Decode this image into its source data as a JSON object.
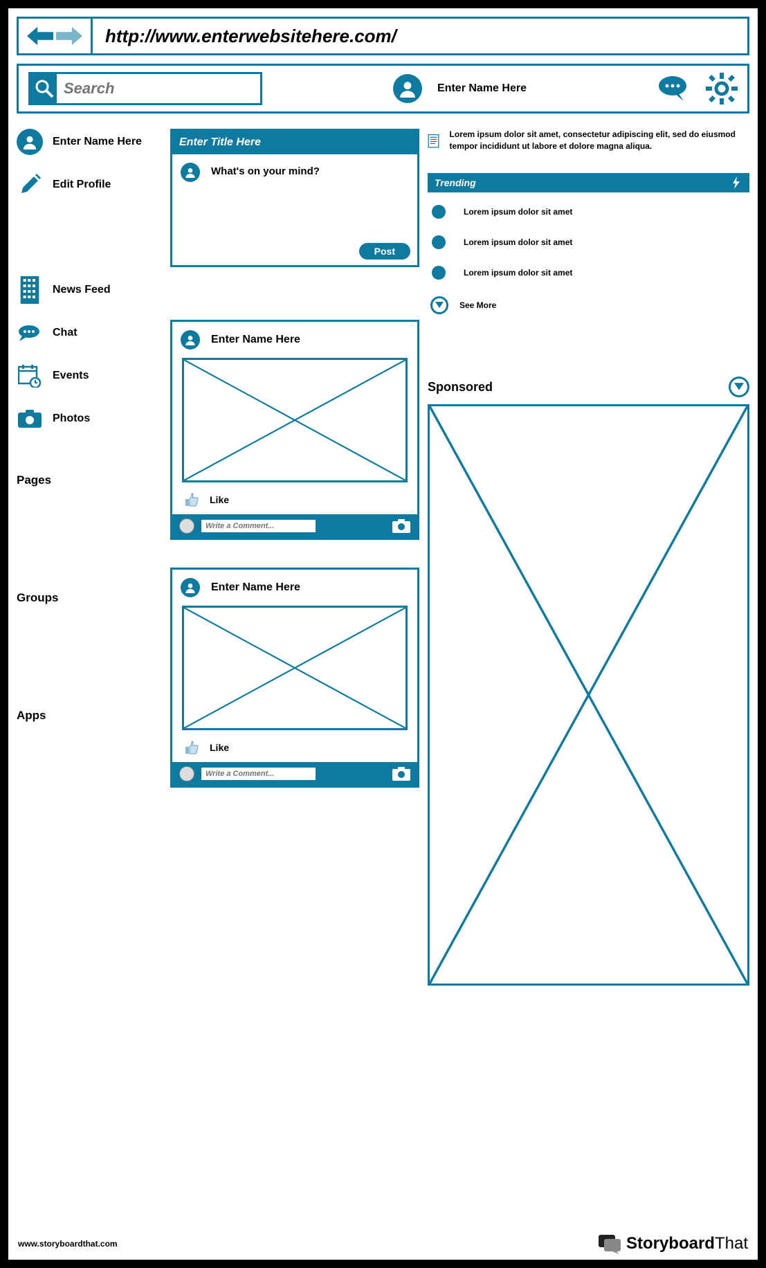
{
  "url": "http://www.enterwebsitehere.com/",
  "search_placeholder": "Search",
  "top_name": "Enter Name Here",
  "sidebar": {
    "name": "Enter Name Here",
    "edit": "Edit Profile",
    "items": [
      {
        "label": "News Feed"
      },
      {
        "label": "Chat"
      },
      {
        "label": "Events"
      },
      {
        "label": "Photos"
      }
    ],
    "sections": [
      "Pages",
      "Groups",
      "Apps"
    ]
  },
  "compose": {
    "title": "Enter Title Here",
    "placeholder": "What's on your mind?",
    "post_btn": "Post"
  },
  "feed": [
    {
      "author": "Enter Name Here",
      "like": "Like",
      "comment_ph": "Write a Comment..."
    },
    {
      "author": "Enter Name Here",
      "like": "Like",
      "comment_ph": "Write a Comment..."
    }
  ],
  "right": {
    "doc_text": "Lorem ipsum dolor sit amet, consectetur adipiscing elit, sed do eiusmod tempor incididunt ut labore et dolore magna aliqua.",
    "trending_title": "Trending",
    "trends": [
      "Lorem ipsum dolor sit amet",
      "Lorem ipsum dolor sit amet",
      "Lorem ipsum dolor sit amet"
    ],
    "see_more": "See More",
    "sponsored": "Sponsored"
  },
  "footer": {
    "url": "www.storyboardthat.com",
    "brand_a": "Storyboard",
    "brand_b": "That"
  }
}
